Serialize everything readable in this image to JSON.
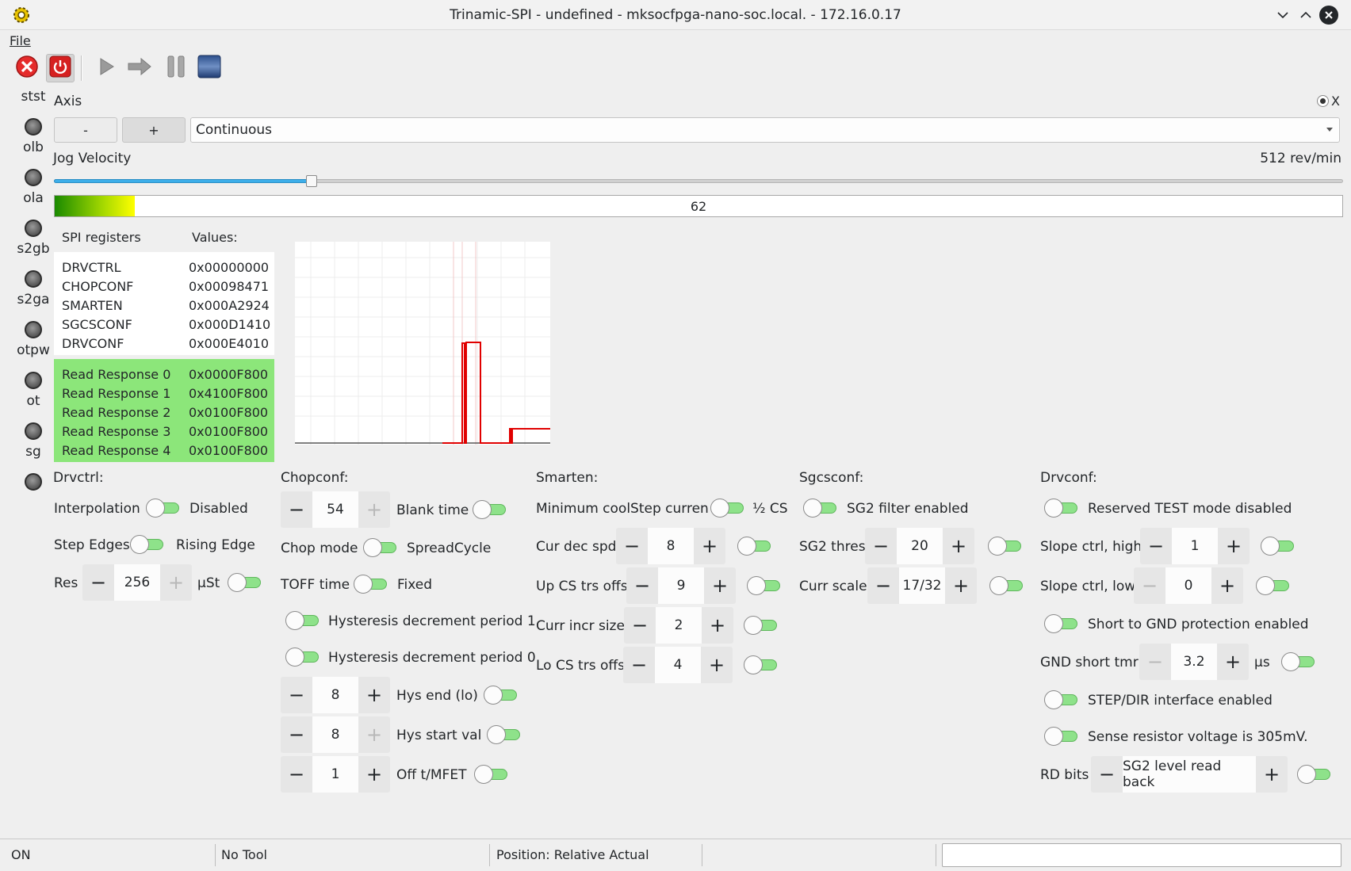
{
  "window": {
    "title": "Trinamic-SPI - undefined - mksocfpga-nano-soc.local. - 172.16.0.17"
  },
  "menu": {
    "file": "File"
  },
  "leds": [
    "stst",
    "olb",
    "ola",
    "s2gb",
    "s2ga",
    "otpw",
    "ot",
    "sg"
  ],
  "axis": {
    "label": "Axis",
    "radio_label": "X",
    "minus": "-",
    "plus": "+",
    "mode": "Continuous"
  },
  "jog": {
    "label": "Jog Velocity",
    "value": "512 rev/min",
    "slider_fraction": 0.2
  },
  "progress": {
    "value": 62,
    "text": "62"
  },
  "spi": {
    "header_name": "SPI registers",
    "header_values": "Values:",
    "registers": [
      {
        "name": "DRVCTRL",
        "value": "0x00000000"
      },
      {
        "name": "CHOPCONF",
        "value": "0x00098471"
      },
      {
        "name": "SMARTEN",
        "value": "0x000A2924"
      },
      {
        "name": "SGCSCONF",
        "value": "0x000D1410"
      },
      {
        "name": "DRVCONF",
        "value": "0x000E4010"
      }
    ],
    "responses": [
      {
        "name": "Read Response 0",
        "value": "0x0000F800"
      },
      {
        "name": "Read Response 1",
        "value": "0x4100F800"
      },
      {
        "name": "Read Response 2",
        "value": "0x0100F800"
      },
      {
        "name": "Read Response 3",
        "value": "0x0100F800"
      },
      {
        "name": "Read Response 4",
        "value": "0x0100F800"
      }
    ]
  },
  "drvctrl": {
    "title": "Drvctrl:",
    "interpolation_label": "Interpolation",
    "interpolation_state": "Disabled",
    "step_edges_label": "Step Edges",
    "step_edges_state": "Rising Edge",
    "res_label": "Res",
    "res_value": "256",
    "res_unit": "µSt"
  },
  "chopconf": {
    "title": "Chopconf:",
    "blank_value": "54",
    "blank_label": "Blank time",
    "chop_mode_label": "Chop mode",
    "chop_mode_state": "SpreadCycle",
    "toff_label": "TOFF time",
    "toff_state": "Fixed",
    "hys_dec1": "Hysteresis decrement period 1",
    "hys_dec0": "Hysteresis decrement period 0",
    "hys_end_value": "8",
    "hys_end_label": "Hys end (lo)",
    "hys_start_value": "8",
    "hys_start_label": "Hys start val",
    "off_value": "1",
    "off_label": "Off t/MFET"
  },
  "smarten": {
    "title": "Smarten:",
    "min_cs_label": "Minimum coolStep curren",
    "min_cs_state": "½ CS",
    "cur_dec_label": "Cur dec spd",
    "cur_dec_value": "8",
    "up_cs_label": "Up CS trs offs",
    "up_cs_value": "9",
    "curr_incr_label": "Curr incr size",
    "curr_incr_value": "2",
    "lo_cs_label": "Lo CS trs offs",
    "lo_cs_value": "4"
  },
  "sgcsconf": {
    "title": "Sgcsconf:",
    "filter_label": "SG2 filter enabled",
    "thres_label": "SG2 thres",
    "thres_value": "20",
    "curr_scale_label": "Curr scale",
    "curr_scale_value": "17/32"
  },
  "drvconf": {
    "title": "Drvconf:",
    "test_mode": "Reserved TEST mode disabled",
    "slope_high_label": "Slope ctrl, high",
    "slope_high_value": "1",
    "slope_low_label": "Slope ctrl, low",
    "slope_low_value": "0",
    "short_gnd": "Short to GND protection enabled",
    "gnd_tmr_label": "GND short tmr",
    "gnd_tmr_value": "3.2",
    "gnd_tmr_unit": "µs",
    "stepdir": "STEP/DIR interface enabled",
    "sense": "Sense resistor voltage is 305mV.",
    "rd_label": "RD bits",
    "rd_value": "SG2 level read back"
  },
  "status": {
    "state": "ON",
    "tool": "No Tool",
    "position": "Position: Relative Actual"
  },
  "colors": {
    "accent": "#3daee9",
    "toggle_on": "#8ee28a",
    "response_bg": "#8ce67a",
    "plot_line": "#e00000"
  },
  "icons": [
    "gear-icon",
    "chevron-down-icon",
    "chevron-up-icon",
    "close-icon",
    "estop-icon",
    "power-icon",
    "play-icon",
    "step-icon",
    "pause-icon",
    "stop-icon"
  ]
}
